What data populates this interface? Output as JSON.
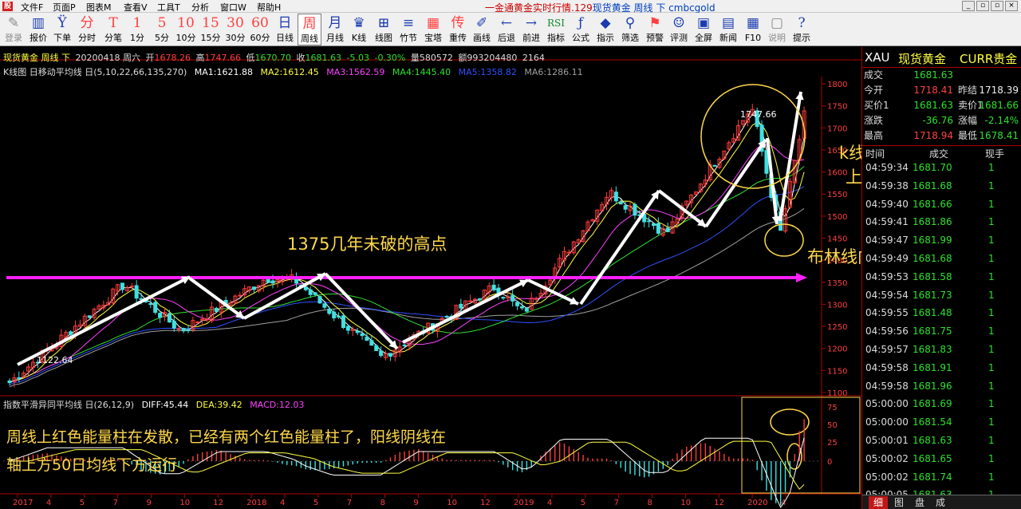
{
  "menubar": {
    "app_icon": "股",
    "menus": [
      "文件F",
      "页面P",
      "图表M",
      "查看V",
      "工具T",
      "分析",
      "窗口W",
      "帮助H"
    ],
    "title_prefix": "一金通黄金实时行情.129",
    "title_main": "现货黄金 周线 下 cmbcgold",
    "controls": [
      "_",
      "▫",
      "▫",
      "×"
    ]
  },
  "toolbar": {
    "items": [
      {
        "icon": "✎",
        "label": "登录",
        "color": "grey"
      },
      {
        "icon": "▥",
        "label": "报价",
        "color": "blue"
      },
      {
        "icon": "Ÿ",
        "label": "下单",
        "color": "blue"
      },
      {
        "icon": "分",
        "label": "分时",
        "color": "red"
      },
      {
        "icon": "T",
        "label": "分笔",
        "color": "red"
      },
      {
        "icon": "1",
        "label": "1分",
        "color": "red"
      },
      {
        "icon": "5",
        "label": "5分",
        "color": "red"
      },
      {
        "icon": "10",
        "label": "10分",
        "color": "red"
      },
      {
        "icon": "15",
        "label": "15分",
        "color": "red"
      },
      {
        "icon": "30",
        "label": "30分",
        "color": "red"
      },
      {
        "icon": "60",
        "label": "60分",
        "color": "red"
      },
      {
        "icon": "日",
        "label": "日线",
        "color": "blue"
      },
      {
        "icon": "周",
        "label": "周线",
        "color": "red",
        "active": true
      },
      {
        "icon": "月",
        "label": "月线",
        "color": "blue"
      },
      {
        "icon": "♛",
        "label": "K线",
        "color": "blue"
      },
      {
        "icon": "⊞",
        "label": "线图",
        "color": "blue"
      },
      {
        "icon": "≡",
        "label": "竹节",
        "color": "blue"
      },
      {
        "icon": "▦",
        "label": "宝塔",
        "color": "red"
      },
      {
        "icon": "传",
        "label": "重传",
        "color": "red"
      },
      {
        "icon": "✐",
        "label": "画线",
        "color": "blue"
      },
      {
        "icon": "←",
        "label": "后退",
        "color": "blue"
      },
      {
        "icon": "→",
        "label": "前进",
        "color": "blue"
      },
      {
        "icon": "RSI",
        "label": "指标",
        "color": "green"
      },
      {
        "icon": "ƒ",
        "label": "公式",
        "color": "blue"
      },
      {
        "icon": "◆",
        "label": "指示",
        "color": "blue"
      },
      {
        "icon": "⚲",
        "label": "筛选",
        "color": "blue"
      },
      {
        "icon": "⚑",
        "label": "预警",
        "color": "red"
      },
      {
        "icon": "☺",
        "label": "评测",
        "color": "blue"
      },
      {
        "icon": "▣",
        "label": "全屏",
        "color": "blue"
      },
      {
        "icon": "▤",
        "label": "新闻",
        "color": "blue"
      },
      {
        "icon": "▦",
        "label": "F10",
        "color": "blue"
      },
      {
        "icon": "▢",
        "label": "说明",
        "color": "grey"
      },
      {
        "icon": "?",
        "label": "提示",
        "color": "blue"
      }
    ]
  },
  "chart_info": {
    "name": "现货黄金 周线 下",
    "date": "20200418 周六",
    "open_label": "开",
    "open": "1678.26",
    "high_label": "高",
    "high": "1747.66",
    "low_label": "低",
    "low": "1670.70",
    "close_label": "收",
    "close": "1681.63",
    "change": "-5.03",
    "change_pct": "-0.30%",
    "vol": "量580572",
    "amount": "额993204480",
    "extra": "2164"
  },
  "ma_line": {
    "prefix": "K线图 日移动平均线 日(5,10,22,66,135,270)",
    "ma1": "MA1:1621.88",
    "ma2": "MA2:1612.45",
    "ma3": "MA3:1562.59",
    "ma4": "MA4:1445.40",
    "ma5": "MA5:1358.82",
    "ma6": "MA6:1286.11"
  },
  "macd_info": {
    "prefix": "指数平滑异同平均线 日(26,12,9)",
    "diff": "DIFF:45.44",
    "dea": "DEA:39.42",
    "macd": "MACD:12.03"
  },
  "annotations": {
    "high_label": "1375几年未破的高点",
    "boll_label": "布林线向上发散",
    "k_label_1": "k线整体在布林线",
    "k_label_2": "上轨运行",
    "low_value": "1122.64",
    "peak_value": "1747.66",
    "macd_note_1": "周线上红色能量柱在发散，已经有两个红色能量柱了，阳线阴线在",
    "macd_note_2": "轴上方50日均线下方运行"
  },
  "chart_data": {
    "type": "candlestick",
    "price_axis": [
      "1800",
      "1750",
      "1700",
      "1650",
      "1600",
      "1550",
      "1500",
      "1450",
      "1400",
      "1350",
      "1300",
      "1250",
      "1200",
      "1150",
      "1100"
    ],
    "macd_axis": [
      "75",
      "50",
      "25",
      "0"
    ],
    "x_axis": [
      "2017",
      "4",
      "5",
      "7",
      "9",
      "10",
      "12",
      "2018",
      "4",
      "5",
      "7",
      "8",
      "9",
      "10",
      "12",
      "2019",
      "4",
      "5",
      "7",
      "8",
      "10",
      "12",
      "2020",
      "4"
    ],
    "ylim": [
      1100,
      1800
    ],
    "swing_points": [
      [
        0,
        1122.64
      ],
      [
        4,
        1345
      ],
      [
        6,
        1240
      ],
      [
        9,
        1360
      ],
      [
        10,
        1355
      ],
      [
        13,
        1180
      ],
      [
        17,
        1340
      ],
      [
        18,
        1280
      ],
      [
        21,
        1555
      ],
      [
        23,
        1460
      ],
      [
        26,
        1747.66
      ],
      [
        27,
        1460
      ],
      [
        28,
        1780
      ]
    ]
  },
  "right_panel": {
    "code": "XAU",
    "name": "现货黄金",
    "currency": "CURR贵金",
    "quote_rows": [
      {
        "k": "成交",
        "v": "1681.63",
        "vc": "green"
      },
      {
        "k": "今开",
        "v": "1718.41",
        "vc": "red",
        "k2": "昨结",
        "v2": "1718.39",
        "v2c": "white"
      },
      {
        "k": "买价1",
        "v": "1681.63",
        "vc": "green",
        "k2": "卖价1",
        "v2": "1681.66",
        "v2c": "green"
      },
      {
        "k": "涨跌",
        "v": "-36.76",
        "vc": "green",
        "k2": "涨幅",
        "v2": "-2.14%",
        "v2c": "green"
      },
      {
        "k": "最高",
        "v": "1718.94",
        "vc": "red",
        "k2": "最低",
        "v2": "1678.41",
        "v2c": "green"
      }
    ],
    "tick_head": [
      "时间",
      "成交",
      "现手"
    ],
    "ticks": [
      {
        "t": "04:59:34",
        "p": "1681.70",
        "v": "1"
      },
      {
        "t": "04:59:38",
        "p": "1681.68",
        "v": "1"
      },
      {
        "t": "04:59:40",
        "p": "1681.66",
        "v": "1"
      },
      {
        "t": "04:59:41",
        "p": "1681.86",
        "v": "1"
      },
      {
        "t": "04:59:47",
        "p": "1681.99",
        "v": "1"
      },
      {
        "t": "04:59:49",
        "p": "1681.68",
        "v": "1"
      },
      {
        "t": "04:59:53",
        "p": "1681.58",
        "v": "1"
      },
      {
        "t": "04:59:54",
        "p": "1681.73",
        "v": "1"
      },
      {
        "t": "04:59:55",
        "p": "1681.48",
        "v": "1"
      },
      {
        "t": "04:59:56",
        "p": "1681.75",
        "v": "1"
      },
      {
        "t": "04:59:57",
        "p": "1681.83",
        "v": "1"
      },
      {
        "t": "04:59:58",
        "p": "1681.91",
        "v": "1"
      },
      {
        "t": "04:59:58",
        "p": "1681.96",
        "v": "1"
      },
      {
        "t": "05:00:00",
        "p": "1681.69",
        "v": "1"
      },
      {
        "t": "05:00:00",
        "p": "1681.54",
        "v": "1"
      },
      {
        "t": "05:00:01",
        "p": "1681.63",
        "v": "1"
      },
      {
        "t": "05:00:02",
        "p": "1681.65",
        "v": "1"
      },
      {
        "t": "05:00:02",
        "p": "1681.74",
        "v": "1"
      },
      {
        "t": "05:00:05",
        "p": "1681.63",
        "v": "1"
      }
    ],
    "tabs": [
      "细",
      "图",
      "盘",
      "成"
    ]
  },
  "colors": {
    "up": "#ff3c3c",
    "down": "#40e0e0",
    "magenta": "#ff20ff",
    "gold": "#ffd84a",
    "white": "#ffffff"
  }
}
